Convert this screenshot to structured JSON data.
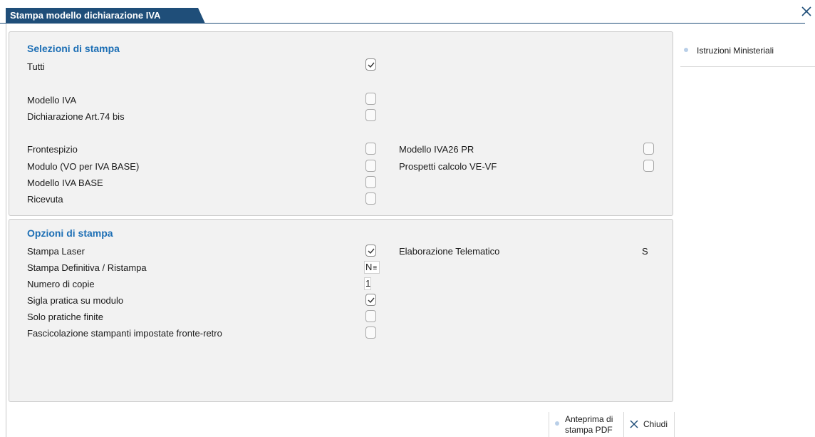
{
  "window": {
    "title": "Stampa modello dichiarazione IVA",
    "close_icon": "close-icon"
  },
  "sidebar": {
    "items": [
      {
        "label": "Istruzioni Ministeriali"
      }
    ]
  },
  "selezioni": {
    "title": "Selezioni di stampa",
    "tutti": {
      "label": "Tutti",
      "checked": true
    },
    "modello_iva": {
      "label": "Modello IVA",
      "checked": false
    },
    "dichiarazione": {
      "label": "Dichiarazione Art.74 bis",
      "checked": false
    },
    "frontespizio": {
      "label": "Frontespizio",
      "checked": false
    },
    "modulo": {
      "label": "Modulo (VO per IVA BASE)",
      "checked": false
    },
    "modello_iva_base": {
      "label": "Modello IVA BASE",
      "checked": false
    },
    "ricevuta": {
      "label": "Ricevuta",
      "checked": false
    },
    "modello_iva26": {
      "label": "Modello IVA26 PR",
      "checked": false
    },
    "prospetti": {
      "label": "Prospetti calcolo VE-VF",
      "checked": false
    }
  },
  "opzioni": {
    "title": "Opzioni di stampa",
    "stampa_laser": {
      "label": "Stampa Laser",
      "checked": true
    },
    "stampa_definitiva": {
      "label": "Stampa Definitiva / Ristampa",
      "value": "N"
    },
    "numero_copie": {
      "label": "Numero di copie",
      "value": "1"
    },
    "sigla_pratica": {
      "label": "Sigla pratica su modulo",
      "checked": true
    },
    "solo_pratiche": {
      "label": "Solo pratiche finite",
      "checked": false
    },
    "fascicolazione": {
      "label": "Fascicolazione stampanti impostate fronte-retro",
      "checked": false
    },
    "elaborazione": {
      "label": "Elaborazione Telematico",
      "value": "S"
    }
  },
  "footer": {
    "anteprima_line1": "Anteprima di",
    "anteprima_line2": "stampa PDF",
    "chiudi": "Chiudi"
  },
  "colors": {
    "accent": "#1f4e79",
    "section_title": "#1d6fb5",
    "panel_bg": "#f2f2f2"
  }
}
